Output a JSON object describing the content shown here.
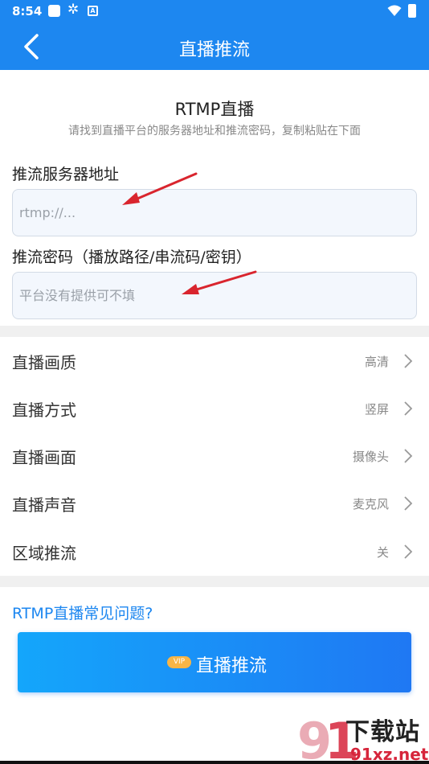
{
  "status_bar": {
    "time": "8:54"
  },
  "header": {
    "title": "直播推流"
  },
  "intro": {
    "title": "RTMP直播",
    "subtitle": "请找到直播平台的服务器地址和推流密码，复制粘贴在下面"
  },
  "server_field": {
    "label": "推流服务器地址",
    "placeholder": "rtmp://...",
    "value": ""
  },
  "key_field": {
    "label": "推流密码（播放路径/串流码/密钥）",
    "placeholder": "平台没有提供可不填",
    "value": ""
  },
  "settings": [
    {
      "label": "直播画质",
      "value": "高清"
    },
    {
      "label": "直播方式",
      "value": "竖屏"
    },
    {
      "label": "直播画面",
      "value": "摄像头"
    },
    {
      "label": "直播声音",
      "value": "麦克风"
    },
    {
      "label": "区域推流",
      "value": "关"
    }
  ],
  "faq_link": "RTMP直播常见问题?",
  "live_button": {
    "badge": "VIP",
    "label": "直播推流"
  },
  "watermark": {
    "name": "下载站",
    "url": "91xz.net"
  },
  "colors": {
    "primary": "#1d87f0",
    "arrow": "#d9252e",
    "vip_badge": "#f7b546",
    "divider": "#f0f0f0"
  },
  "icons": {
    "back": "chevron-left-icon",
    "row_arrow": "chevron-right-icon",
    "annotation": "red-arrow-icon"
  }
}
